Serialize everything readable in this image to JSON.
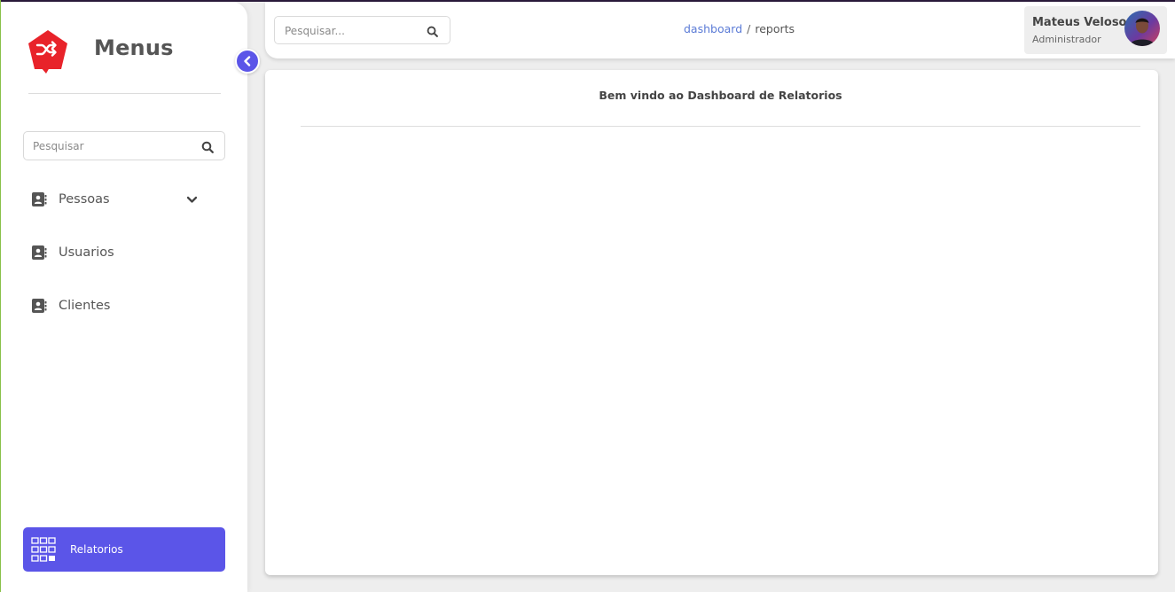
{
  "sidebar": {
    "title": "Menus",
    "search": {
      "placeholder": "Pesquisar"
    },
    "items": [
      {
        "label": "Pessoas",
        "icon": "contact-book-icon",
        "has_dropdown": true
      },
      {
        "label": "Usuarios",
        "icon": "contact-book-icon"
      },
      {
        "label": "Clientes",
        "icon": "contact-book-icon"
      }
    ],
    "bottom_button": {
      "label": "Relatorios",
      "icon": "grid-icon"
    }
  },
  "topbar": {
    "search": {
      "placeholder": "Pesquisar..."
    },
    "breadcrumb": {
      "link": "dashboard",
      "separator": "/",
      "current": "reports"
    },
    "user": {
      "name": "Mateus Veloso",
      "role": "Administrador"
    }
  },
  "main": {
    "title": "Bem vindo ao Dashboard de Relatorios"
  },
  "colors": {
    "accent": "#5b55e8",
    "logo_red": "#e8232a",
    "breadcrumb_link": "#5b7bd6",
    "background": "#eeeeee"
  }
}
